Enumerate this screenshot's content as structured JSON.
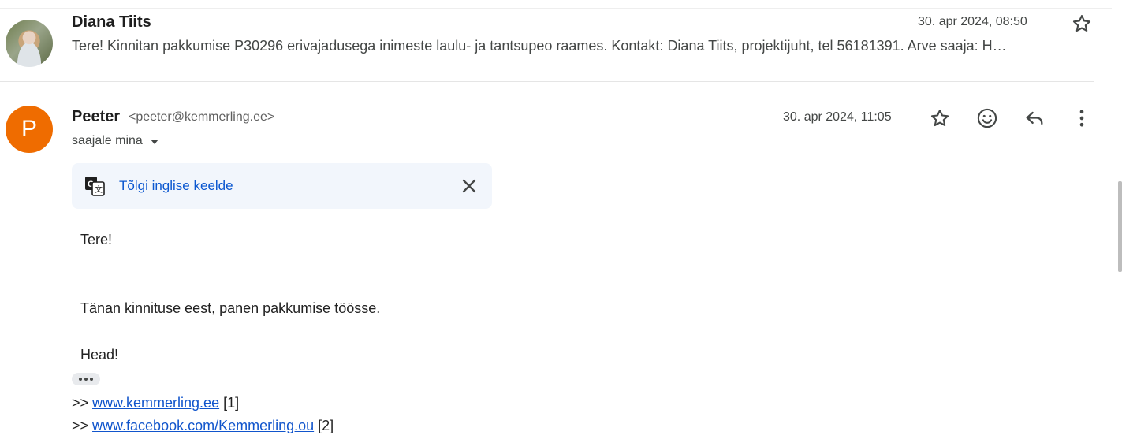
{
  "collapsed_message": {
    "sender": "Diana Tiits",
    "date": "30. apr 2024, 08:50",
    "snippet": "Tere! Kinnitan pakkumise P30296 erivajadusega inimeste laulu- ja tantsupeo raames. Kontakt: Diana Tiits, projektijuht, tel 56181391. Arve saaja: H…"
  },
  "message": {
    "avatar_letter": "P",
    "sender_name": "Peeter",
    "sender_email": "<peeter@kemmerling.ee>",
    "recipient_label": "saajale mina",
    "date": "30. apr 2024, 11:05",
    "translate_label": "Tõlgi inglise keelde",
    "body": {
      "greeting": "Tere!",
      "line1": "Tänan kinnituse eest, panen pakkumise töösse.",
      "closing": "Head!"
    },
    "signature": [
      {
        "prefix": ">> ",
        "link": "www.kemmerling.ee",
        "suffix": " [1]"
      },
      {
        "prefix": ">> ",
        "link": "www.facebook.com/Kemmerling.ou",
        "suffix": " [2]"
      }
    ]
  },
  "colors": {
    "avatar_orange": "#ef6c00",
    "link_blue": "#0b57d0",
    "translate_bg": "#f2f6fc"
  },
  "icons": [
    "star-icon",
    "emoji-icon",
    "reply-icon",
    "more-vert-icon",
    "translate-icon",
    "close-icon"
  ]
}
